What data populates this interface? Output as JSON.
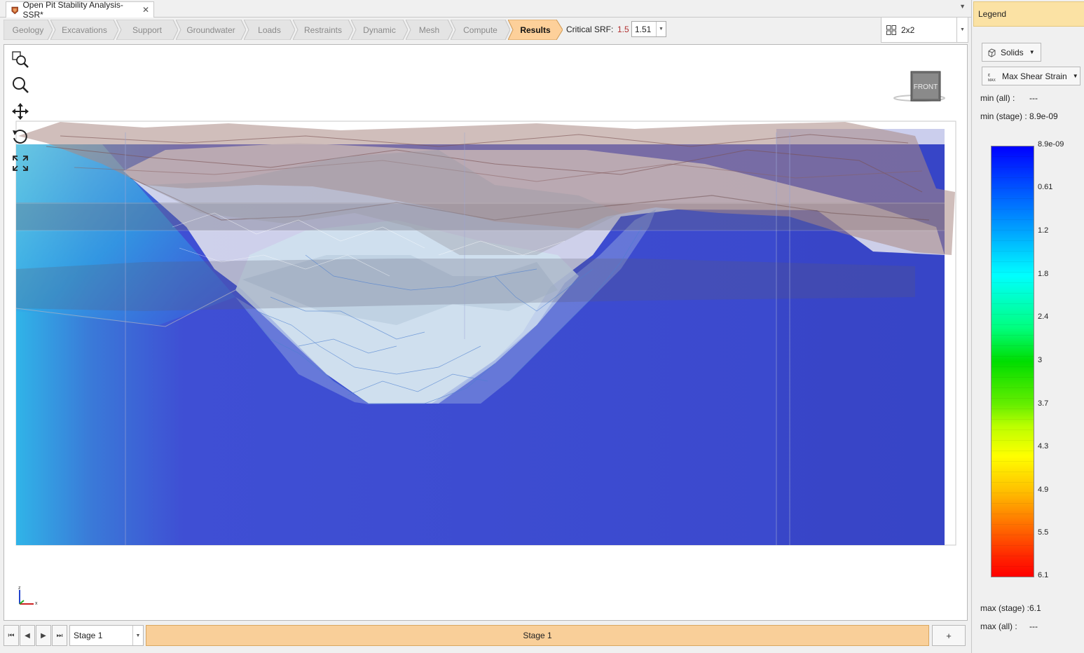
{
  "document": {
    "tab_title": "Open Pit Stability Analysis-SSR*",
    "close_glyph": "✕",
    "dropdown_glyph": "▼"
  },
  "workflow": {
    "steps": [
      "Geology",
      "Excavations",
      "Support",
      "Groundwater",
      "Loads",
      "Restraints",
      "Dynamic",
      "Mesh",
      "Compute",
      "Results"
    ],
    "active_step": "Results",
    "critical_srf_label": "Critical SRF:",
    "critical_srf_value": "1.5",
    "srf_select_value": "1.51",
    "layout_value": "2x2",
    "colors": {
      "active_step_fill": "#fdd09a",
      "step_fill": "#e4e4e4",
      "srf_value_color": "#b03030"
    }
  },
  "viewport": {
    "tools": [
      "zoom-window-icon",
      "zoom-icon",
      "pan-icon",
      "rotate-icon",
      "zoom-extents-icon"
    ],
    "view_cube_label": "FRONT",
    "axis_labels": {
      "z": "z",
      "x": "x"
    }
  },
  "stage_bar": {
    "selected_stage": "Stage 1",
    "stage_tab_label": "Stage 1",
    "add_label": "+"
  },
  "legend": {
    "title": "Legend",
    "solids_label": "Solids",
    "result_label": "Max Shear Strain",
    "min_all_label": "min (all) :",
    "min_all_value": "---",
    "min_stage_label": "min (stage) :",
    "min_stage_value": "8.9e-09",
    "max_stage_label": "max (stage) :",
    "max_stage_value": "6.1",
    "max_all_label": "max (all) :",
    "max_all_value": "---",
    "ticks": [
      "8.9e-09",
      "0.61",
      "1.2",
      "1.8",
      "2.4",
      "3",
      "3.7",
      "4.3",
      "4.9",
      "5.5",
      "6.1"
    ],
    "colormap": [
      "#0000ff",
      "#00a6ff",
      "#00ffff",
      "#00dd00",
      "#bbff00",
      "#ffff00",
      "#ffc000",
      "#ff7000",
      "#ff0000"
    ]
  }
}
